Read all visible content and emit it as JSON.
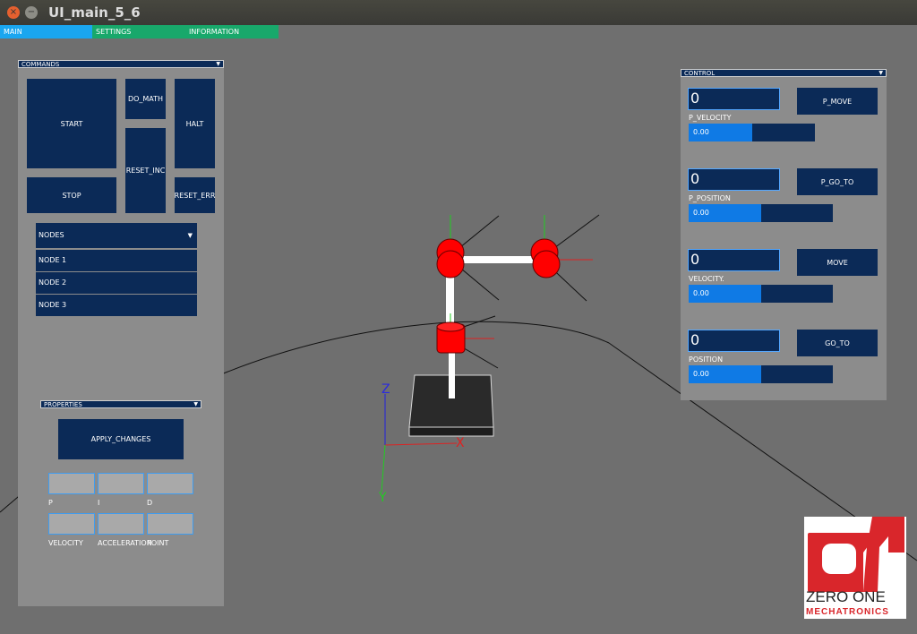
{
  "window": {
    "title": "UI_main_5_6",
    "close_glyph": "×",
    "minimize_glyph": "−"
  },
  "tabs": [
    {
      "label": "MAIN",
      "color": "#1aa6f0"
    },
    {
      "label": "SETTINGS",
      "color": "#18a86b"
    },
    {
      "label": "INFORMATION",
      "color": "#18a86b"
    }
  ],
  "commands": {
    "title": "COMMANDS",
    "start": "START",
    "do_math": "DO_MATH",
    "halt": "HALT",
    "reset_inc": "RESET_INC",
    "stop": "STOP",
    "reset_err": "RESET_ERR",
    "nodes_dropdown": "NODES",
    "nodes": [
      "NODE 1",
      "NODE 2",
      "NODE 3"
    ]
  },
  "properties": {
    "title": "PROPERTIES",
    "apply": "APPLY_CHANGES",
    "row1_labels": [
      "P",
      "I",
      "D"
    ],
    "row2_labels": [
      "VELOCITY",
      "ACCELERATION",
      "POINT"
    ]
  },
  "control": {
    "title": "CONTROL",
    "rows": [
      {
        "field_value": "0",
        "button": "P_MOVE",
        "label": "P_VELOCITY",
        "slider_value": "0.00",
        "fill": 0.5
      },
      {
        "field_value": "0",
        "button": "P_GO_TO",
        "label": "P_POSITION",
        "slider_value": "0.00",
        "fill": 0.5
      },
      {
        "field_value": "0",
        "button": "MOVE",
        "label": "VELOCITY.",
        "slider_value": "0.00",
        "fill": 0.5
      },
      {
        "field_value": "0",
        "button": "GO_TO",
        "label": "POSITION",
        "slider_value": "0.00",
        "fill": 0.5
      }
    ]
  },
  "axes": {
    "x": "X",
    "y": "Y",
    "z": "Z"
  },
  "logo": {
    "line1": "ZERO ONE",
    "line2": "MECHATRONICS"
  },
  "colors": {
    "panel_dark": "#0b2a57",
    "accent_blue": "#0f7ae5",
    "logo_red": "#d9262b",
    "joint_red": "#ff0000"
  }
}
